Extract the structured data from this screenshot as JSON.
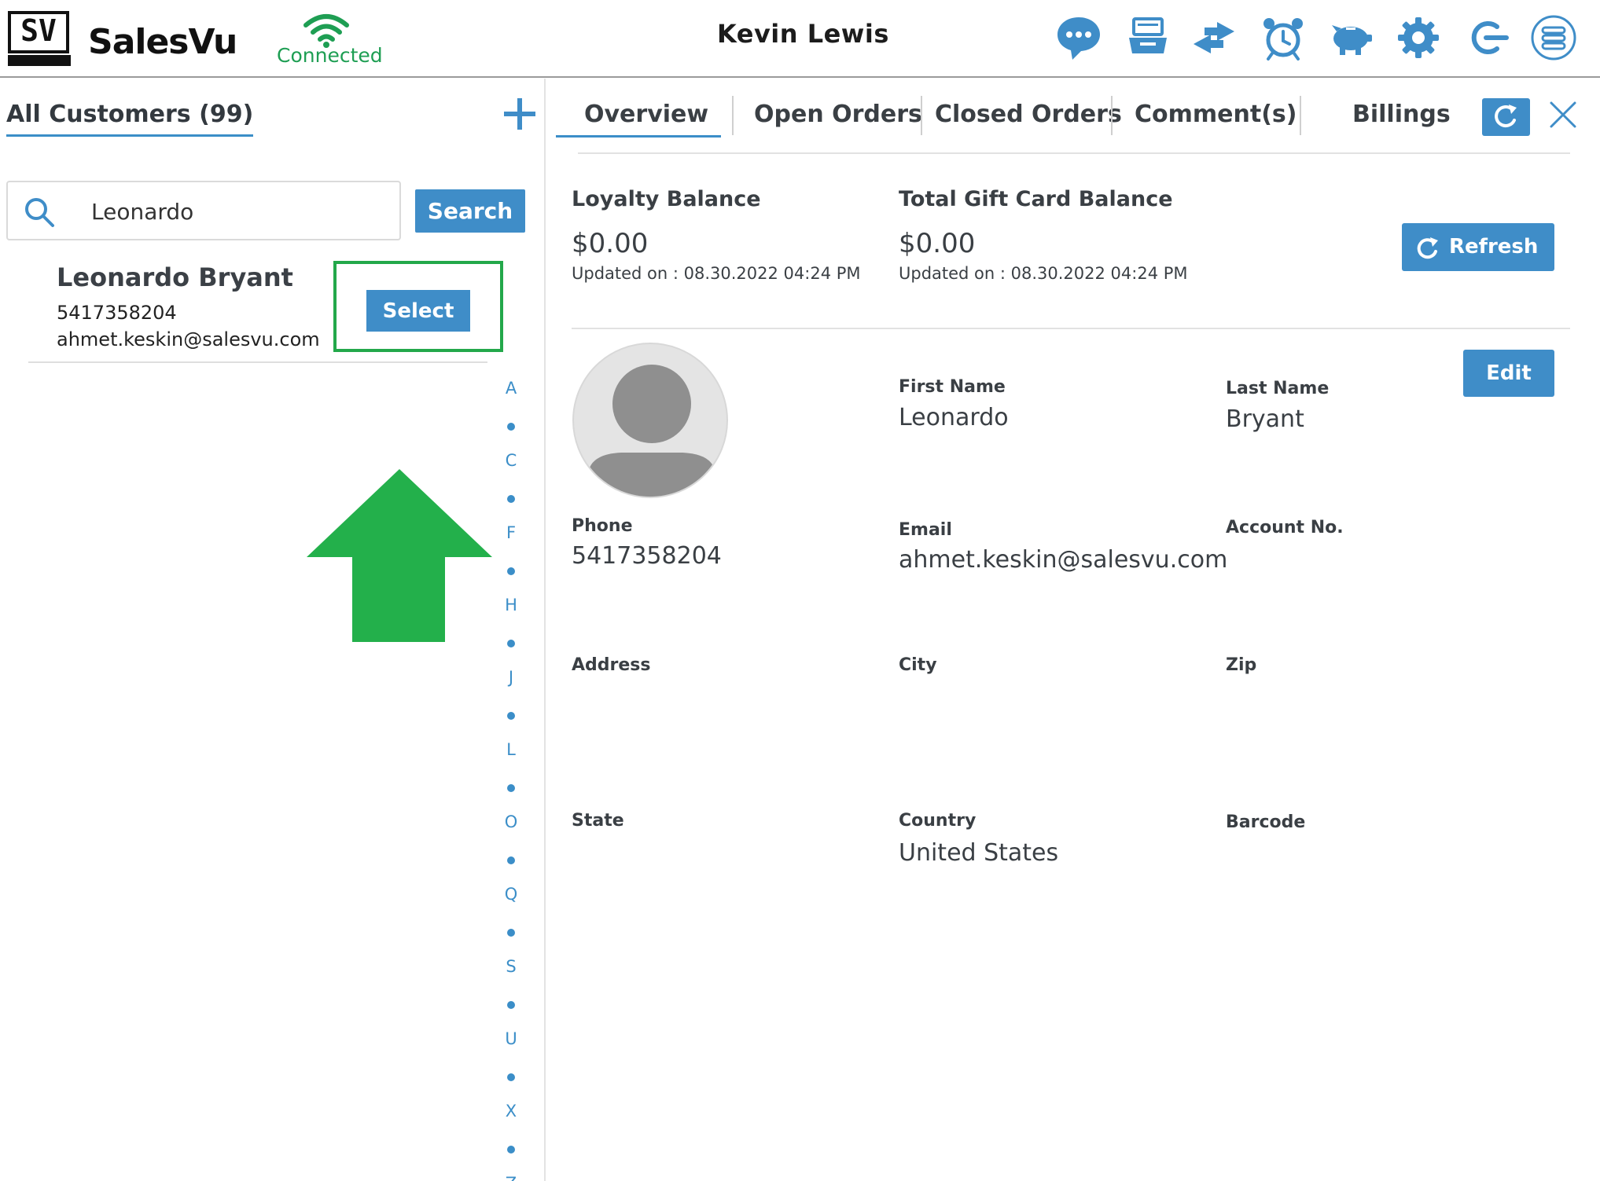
{
  "header": {
    "logo_text": "SV",
    "brand": "SalesVu",
    "connection_status": "Connected",
    "user_name": "Kevin Lewis",
    "icons": [
      "chat-icon",
      "register-icon",
      "transfer-icon",
      "alarm-icon",
      "piggy-bank-icon",
      "settings-icon",
      "logout-icon",
      "menu-list-icon"
    ]
  },
  "colors": {
    "accent": "#3f8dc8",
    "connected": "#1e9e53",
    "highlight": "#23a84a"
  },
  "customers": {
    "title": "All Customers (99)",
    "search_value": "Leonardo",
    "search_button": "Search",
    "result": {
      "name": "Leonardo Bryant",
      "phone": "5417358204",
      "email": "ahmet.keskin@salesvu.com",
      "select_label": "Select"
    },
    "alphabet": [
      "A",
      "C",
      "F",
      "H",
      "J",
      "L",
      "O",
      "Q",
      "S",
      "U",
      "X",
      "Z"
    ]
  },
  "tabs": {
    "overview": "Overview",
    "open_orders": "Open Orders",
    "closed_orders": "Closed Orders",
    "comments": "Comment(s)",
    "billings": "Billings"
  },
  "balances": {
    "loyalty_title": "Loyalty Balance",
    "loyalty_value": "$0.00",
    "loyalty_updated": "Updated on :  08.30.2022 04:24 PM",
    "gift_title": "Total Gift Card Balance",
    "gift_value": "$0.00",
    "gift_updated": "Updated on :  08.30.2022 04:24 PM",
    "refresh_label": "Refresh"
  },
  "details": {
    "edit_label": "Edit",
    "first_name_label": "First Name",
    "first_name": "Leonardo",
    "last_name_label": "Last Name",
    "last_name": "Bryant",
    "phone_label": "Phone",
    "phone": "5417358204",
    "email_label": "Email",
    "email": "ahmet.keskin@salesvu.com",
    "account_label": "Account No.",
    "address_label": "Address",
    "city_label": "City",
    "zip_label": "Zip",
    "state_label": "State",
    "country_label": "Country",
    "country": "United States",
    "barcode_label": "Barcode"
  }
}
